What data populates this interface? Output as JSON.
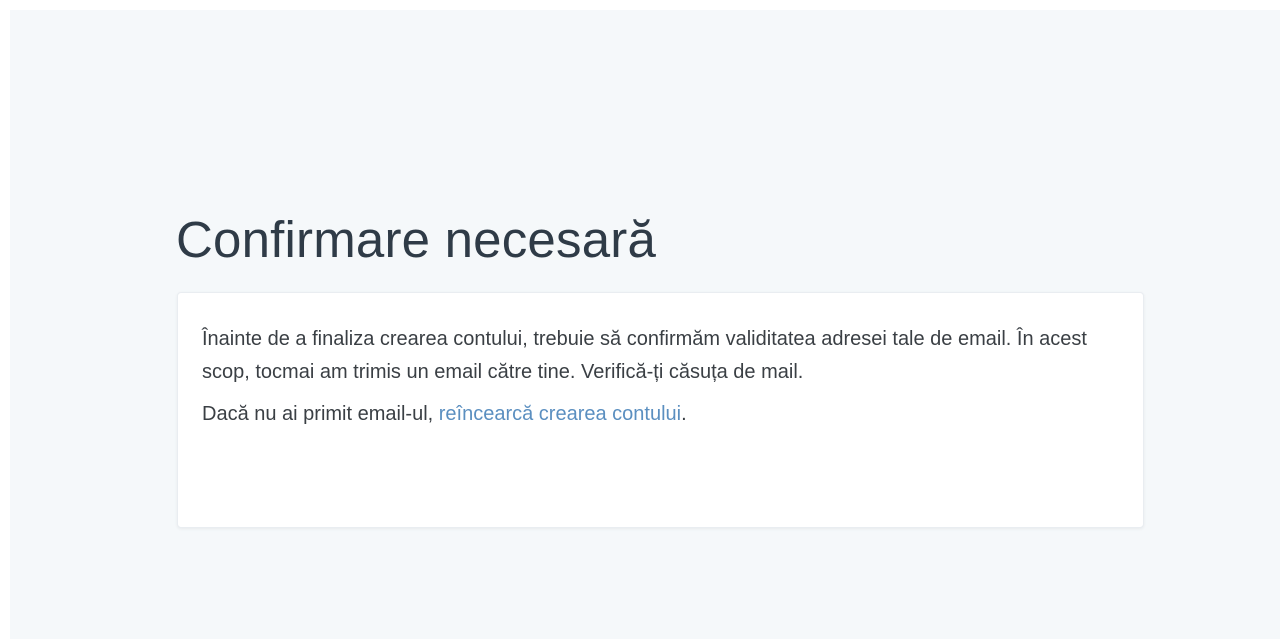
{
  "page": {
    "title": "Confirmare necesară"
  },
  "message": {
    "paragraph1": "Înainte de a finaliza crearea contului, trebuie să confirmăm validitatea adresei tale de email. În acest scop, tocmai am trimis un email către tine. Verifică-ți căsuța de mail.",
    "paragraph2_prefix": "Dacă nu ai primit email-ul, ",
    "retry_link": "reîncearcă crearea contului",
    "paragraph2_suffix": "."
  },
  "colors": {
    "background": "#f5f8fa",
    "card": "#ffffff",
    "title": "#2f3b47",
    "text": "#3a3f44",
    "link": "#5b8fc0"
  }
}
